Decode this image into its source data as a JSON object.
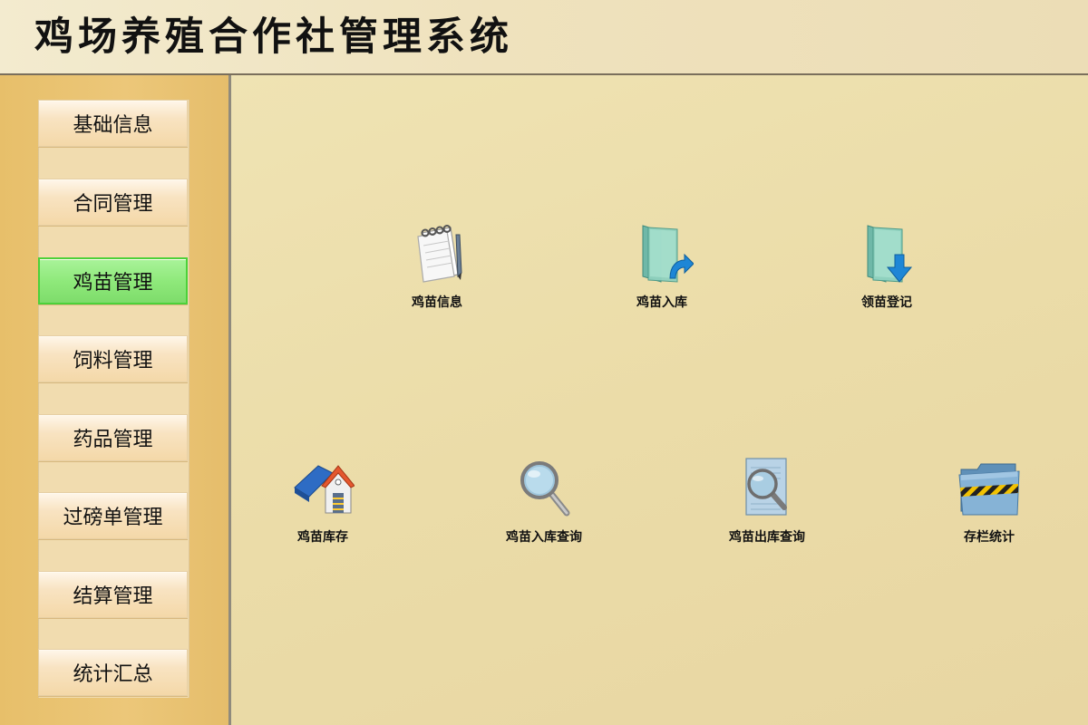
{
  "app": {
    "title": "鸡场养殖合作社管理系统"
  },
  "sidebar": {
    "items": [
      {
        "label": "基础信息",
        "active": false
      },
      {
        "label": "合同管理",
        "active": false
      },
      {
        "label": "鸡苗管理",
        "active": true
      },
      {
        "label": "饲料管理",
        "active": false
      },
      {
        "label": "药品管理",
        "active": false
      },
      {
        "label": "过磅单管理",
        "active": false
      },
      {
        "label": "结算管理",
        "active": false
      },
      {
        "label": "统计汇总",
        "active": false
      }
    ]
  },
  "main": {
    "tiles": [
      {
        "label": "鸡苗信息",
        "icon": "notepad-icon"
      },
      {
        "label": "鸡苗入库",
        "icon": "folder-arrow-in-icon"
      },
      {
        "label": "领苗登记",
        "icon": "folder-arrow-down-icon"
      },
      {
        "label": "鸡苗库存",
        "icon": "warehouse-icon"
      },
      {
        "label": "鸡苗入库查询",
        "icon": "magnifier-icon"
      },
      {
        "label": "鸡苗出库查询",
        "icon": "document-search-icon"
      },
      {
        "label": "存栏统计",
        "icon": "folder-striped-icon"
      }
    ]
  },
  "colors": {
    "active_nav": "#8fe97b",
    "sidebar_bg": "#e7bf6a",
    "main_bg": "#ebdca8"
  }
}
